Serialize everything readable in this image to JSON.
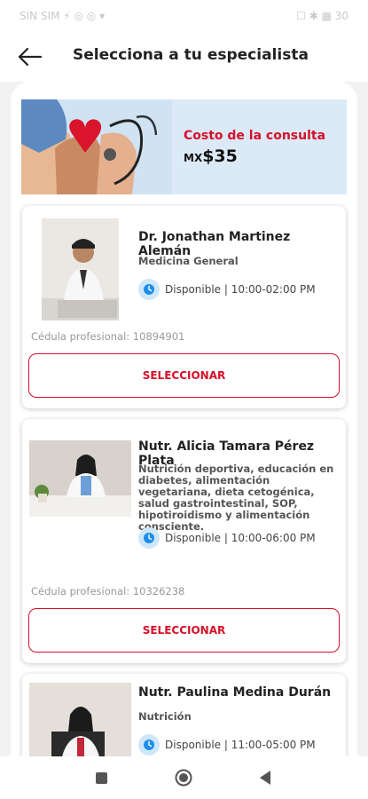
{
  "status_bar": {
    "left_text": "SIN SIM ⚡ ◎ ◎ ▾",
    "right_text": "☐ ✱ ▦ 30"
  },
  "header": {
    "title": "Selecciona a tu especialista",
    "back_icon": "arrow-left-icon"
  },
  "banner": {
    "title": "Costo de la consulta",
    "currency": "MX",
    "price": "$35"
  },
  "specialists": [
    {
      "name": "Dr. Jonathan Martinez Alemán",
      "specialty": "Medicina General",
      "availability": "Disponible | 10:00-02:00 PM",
      "cedula": "Cédula profesional: 10894901",
      "button": "SELECCIONAR"
    },
    {
      "name": "Nutr. Alicia Tamara Pérez Plata",
      "specialty": "Nutrición deportiva, educación en diabetes, alimentación vegetariana, dieta cetogénica, salud gastrointestinal, SOP, hipotiroidismo y alimentación consciente.",
      "availability": "Disponible | 10:00-06:00 PM",
      "cedula": "Cédula profesional: 10326238",
      "button": "SELECCIONAR"
    },
    {
      "name": "Nutr. Paulina Medina Durán",
      "specialty": "Nutrición",
      "availability": "Disponible | 11:00-05:00 PM"
    }
  ],
  "colors": {
    "accent": "#d6102a",
    "banner_bg": "#dbeaf6",
    "clock_bg": "#cfe7fa"
  }
}
